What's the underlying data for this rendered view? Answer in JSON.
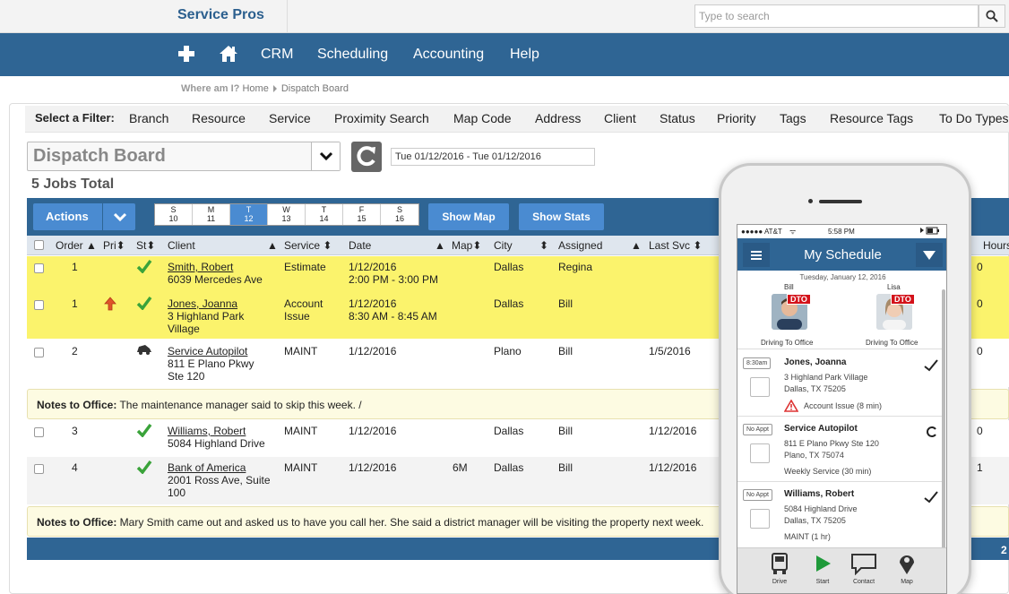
{
  "app": {
    "brand": "Service Pros"
  },
  "search": {
    "placeholder": "Type to search"
  },
  "nav": {
    "items": [
      "CRM",
      "Scheduling",
      "Accounting",
      "Help"
    ]
  },
  "breadcrumb": {
    "label": "Where am I?",
    "home": "Home",
    "current": "Dispatch Board"
  },
  "filter": {
    "label": "Select a Filter:",
    "items": [
      "Branch",
      "Resource",
      "Service",
      "Proximity Search",
      "Map Code",
      "Address",
      "Client",
      "Status",
      "Priority",
      "Tags",
      "Resource Tags",
      "To Do Types"
    ]
  },
  "board": {
    "selected": "Dispatch Board",
    "date_range": "Tue 01/12/2016 - Tue 01/12/2016",
    "jobs_total": "5 Jobs Total"
  },
  "toolbar": {
    "actions": "Actions",
    "days": [
      {
        "l": "S",
        "n": "10"
      },
      {
        "l": "M",
        "n": "11"
      },
      {
        "l": "T",
        "n": "12"
      },
      {
        "l": "W",
        "n": "13"
      },
      {
        "l": "T",
        "n": "14"
      },
      {
        "l": "F",
        "n": "15"
      },
      {
        "l": "S",
        "n": "16"
      }
    ],
    "active_day_index": 2,
    "show_map": "Show Map",
    "show_stats": "Show Stats"
  },
  "columns": {
    "order": "Order",
    "pri": "Pri",
    "st": "St",
    "client": "Client",
    "service": "Service",
    "date": "Date",
    "map": "Map",
    "city": "City",
    "assigned": "Assigned",
    "last_svc": "Last Svc",
    "hours": "Hours"
  },
  "rows": [
    {
      "order": "1",
      "client": "Smith, Robert",
      "addr": [
        "6039 Mercedes Ave"
      ],
      "service": [
        "Estimate"
      ],
      "date": [
        "1/12/2016",
        "2:00 PM - 3:00 PM"
      ],
      "map": "",
      "city": "Dallas",
      "assigned": "Regina",
      "last_svc": "",
      "hours": "0",
      "status": "check",
      "priority": ""
    },
    {
      "order": "1",
      "client": "Jones, Joanna",
      "addr": [
        "3 Highland Park",
        "Village"
      ],
      "service": [
        "Account",
        "Issue"
      ],
      "date": [
        "1/12/2016",
        "8:30 AM - 8:45 AM"
      ],
      "map": "",
      "city": "Dallas",
      "assigned": "Bill",
      "last_svc": "",
      "hours": "0",
      "status": "check",
      "priority": "high"
    },
    {
      "order": "2",
      "client": "Service Autopilot",
      "addr": [
        "811 E Plano Pkwy",
        "Ste 120"
      ],
      "service": [
        "MAINT"
      ],
      "date": [
        "1/12/2016"
      ],
      "map": "",
      "city": "Plano",
      "assigned": "Bill",
      "last_svc": "1/5/2016",
      "hours": "0",
      "status": "car",
      "priority": ""
    },
    {
      "order": "3",
      "client": "Williams, Robert",
      "addr": [
        "5084 Highland Drive"
      ],
      "service": [
        "MAINT"
      ],
      "date": [
        "1/12/2016"
      ],
      "map": "",
      "city": "Dallas",
      "assigned": "Bill",
      "last_svc": "1/12/2016",
      "hours": "0",
      "status": "check",
      "priority": ""
    },
    {
      "order": "4",
      "client": "Bank of America",
      "addr": [
        "2001 Ross Ave, Suite",
        "100"
      ],
      "service": [
        "MAINT"
      ],
      "date": [
        "1/12/2016"
      ],
      "map": "6M",
      "city": "Dallas",
      "assigned": "Bill",
      "last_svc": "1/12/2016",
      "hours": "1",
      "status": "check",
      "priority": ""
    }
  ],
  "notes": [
    {
      "label": "Notes to Office:",
      "text": " The maintenance manager said to skip this week. /"
    },
    {
      "label": "Notes to Office:",
      "text": " Mary Smith came out and asked us to have you call her. She said a district manager will be visiting the property next week."
    }
  ],
  "footer": {
    "right_num": "2"
  },
  "phone": {
    "carrier": "●●●●● AT&T",
    "time": "5:58 PM",
    "title": "My Schedule",
    "date": "Tuesday, January 12, 2016",
    "techs": [
      {
        "name": "Bill",
        "badge": "DTO",
        "status": "Driving To Office"
      },
      {
        "name": "Lisa",
        "badge": "DTO",
        "status": "Driving To Office"
      }
    ],
    "jobs": [
      {
        "tag": "8:30am",
        "name": "Jones, Joanna",
        "lines": [
          "3 Highland Park Village",
          "Dallas, TX 75205"
        ],
        "note": "Account Issue (8 min)"
      },
      {
        "tag": "No Appt",
        "name": "Service Autopilot",
        "lines": [
          "811 E Plano Pkwy Ste 120",
          "Plano, TX 75074"
        ],
        "note": "Weekly Service (30 min)"
      },
      {
        "tag": "No Appt",
        "name": "Williams, Robert",
        "lines": [
          "5084 Highland Drive",
          "Dallas, TX 75205"
        ],
        "note": "MAINT (1 hr)"
      }
    ],
    "tabs": [
      "Drive",
      "Start",
      "Contact",
      "Map"
    ]
  },
  "colors": {
    "nav": "#2f6594",
    "button": "#4a8bd1",
    "highlight": "#fbf36c",
    "check": "#3aa33a",
    "dto": "#d3121a"
  }
}
